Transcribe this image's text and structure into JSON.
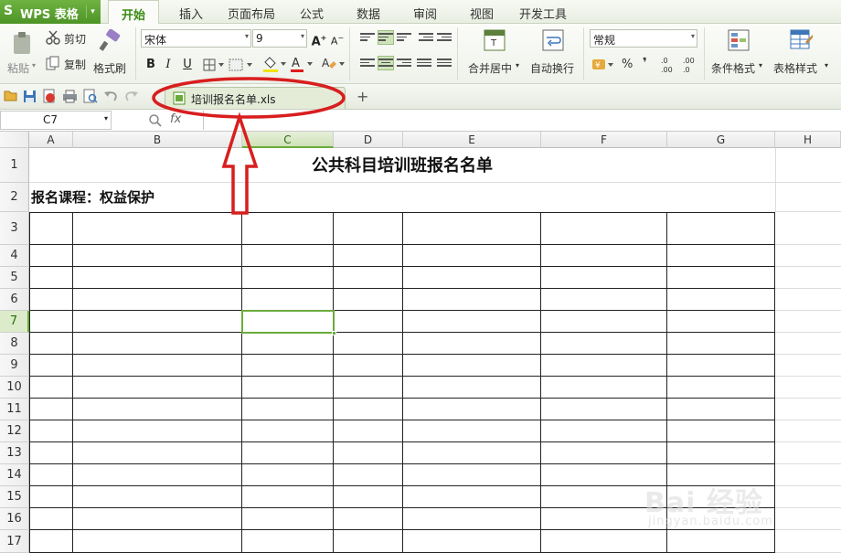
{
  "app": {
    "logo_letter": "S",
    "name": "WPS 表格",
    "menu_arrow": "▾"
  },
  "menu_tabs": [
    "开始",
    "插入",
    "页面布局",
    "公式",
    "数据",
    "审阅",
    "视图",
    "开发工具"
  ],
  "ribbon": {
    "paste": "粘贴",
    "cut": "剪切",
    "copy": "复制",
    "format_painter": "格式刷",
    "font_name": "宋体",
    "font_size": "9",
    "bold": "B",
    "italic": "I",
    "underline": "U",
    "merge_center": "合并居中",
    "wrap_text": "自动换行",
    "number_format": "常规",
    "percent": "%",
    "comma": "❜",
    "conditional_format": "条件格式",
    "table_style": "表格样式",
    "dropdown_arrow": "▾"
  },
  "document_tab": {
    "filename": "培训报名名单.xls",
    "add_label": "+"
  },
  "formula_bar": {
    "cell_ref": "C7",
    "fx": "fx",
    "value": ""
  },
  "sheet": {
    "columns": [
      "A",
      "B",
      "C",
      "D",
      "E",
      "F",
      "G",
      "H"
    ],
    "rows": [
      "1",
      "2",
      "3",
      "4",
      "5",
      "6",
      "7",
      "8",
      "9",
      "10",
      "11",
      "12",
      "13",
      "14",
      "15",
      "16",
      "17"
    ],
    "selected_column": "C",
    "selected_row": "7",
    "title": "公共科目培训班报名名单",
    "subtitle": "报名课程：权益保护"
  },
  "watermark": {
    "brand": "Bai 经验",
    "url": "jingyan.baidu.com"
  },
  "colors": {
    "accent_green": "#6aab3b",
    "logo_green": "#4d9426",
    "annotation_red": "#d81e1e"
  }
}
